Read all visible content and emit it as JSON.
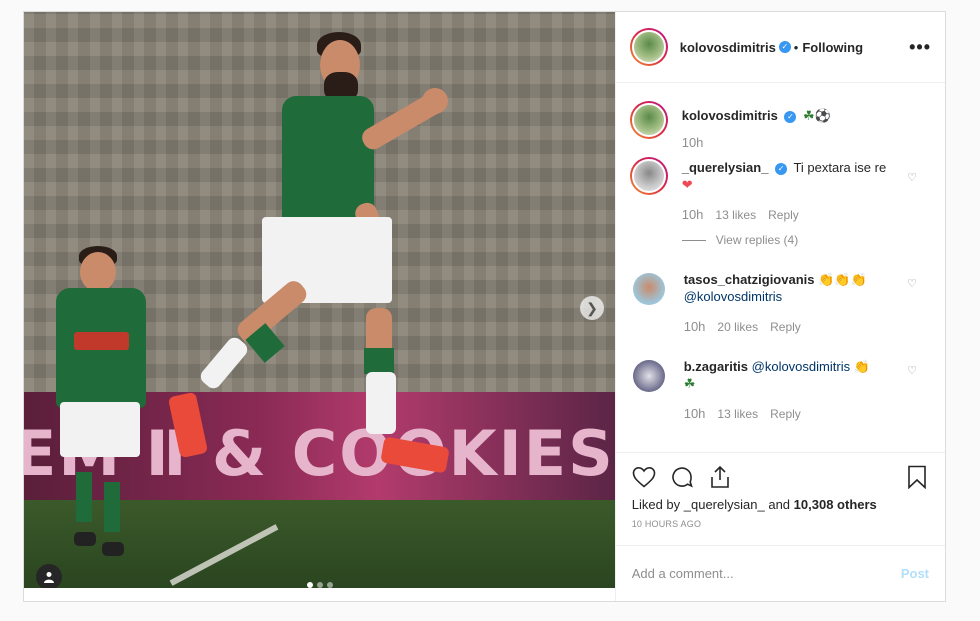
{
  "post": {
    "media": {
      "banner_text": "EM Ⅱ & COOKIES",
      "carousel_dots": 3,
      "active_dot": 0
    },
    "header": {
      "username": "kolovosdimitris",
      "separator": "•",
      "follow_status": "Following",
      "more_label": "•••"
    },
    "caption": {
      "username": "kolovosdimitris",
      "text": "☘⚽",
      "time": "10h"
    },
    "comments": [
      {
        "username": "_querelysian_",
        "text": "Ti pextara ise re",
        "emoji": "❤",
        "time": "10h",
        "likes": "13 likes",
        "reply": "Reply",
        "view_replies": "View replies (4)"
      },
      {
        "username": "tasos_chatzigiovanis",
        "text": "👏👏👏",
        "mention": "@kolovosdimitris",
        "time": "10h",
        "likes": "20 likes",
        "reply": "Reply"
      },
      {
        "username": "b.zagaritis",
        "mention": "@kolovosdimitris",
        "emoji": "👏",
        "text2": "☘",
        "time": "10h",
        "likes": "13 likes",
        "reply": "Reply"
      }
    ],
    "likes": {
      "prefix": "Liked by",
      "user": "_querelysian_",
      "middle": "and",
      "others": "10,308 others"
    },
    "timestamp": "10 HOURS AGO",
    "add_comment_placeholder": "Add a comment...",
    "post_button": "Post"
  },
  "colors": {
    "verified": "#3897f0",
    "post_button": "#b2dffc",
    "heart": "#ed4956"
  }
}
